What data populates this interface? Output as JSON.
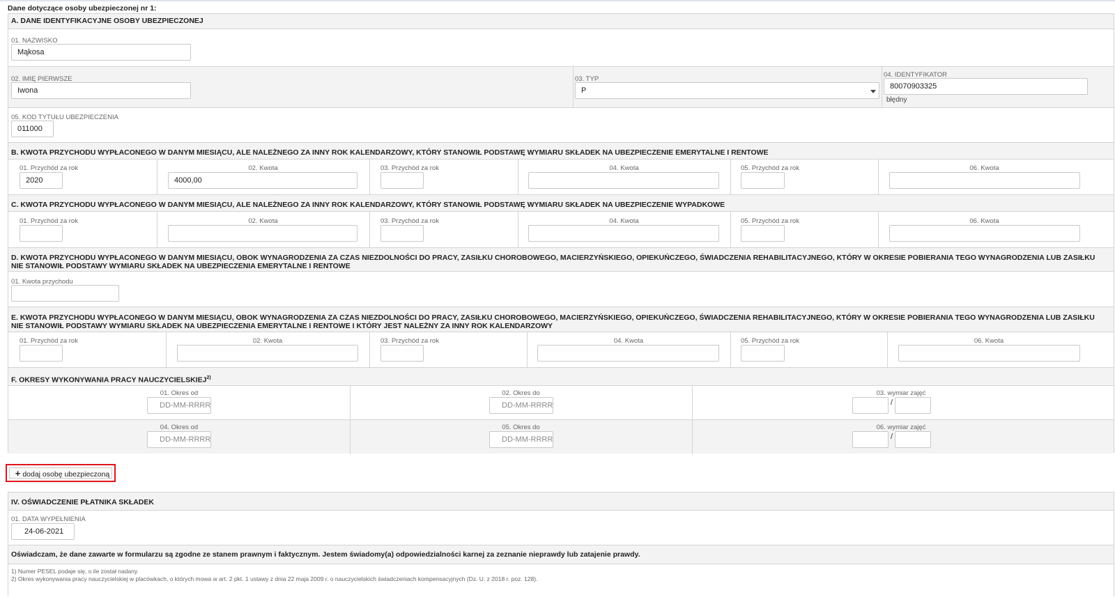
{
  "page_title": "Dane dotyczące osoby ubezpieczonej nr 1:",
  "section_a": {
    "title": "A. DANE IDENTYFIKACYJNE OSOBY UBEZPIECZONEJ",
    "nazwisko_label": "01. NAZWISKO",
    "nazwisko_value": "Mąkosa",
    "imie_label": "02. IMIĘ PIERWSZE",
    "imie_value": "Iwona",
    "typ_label": "03. TYP",
    "typ_value": "P",
    "identyfikator_label": "04. IDENTYFIKATOR",
    "identyfikator_value": "80070903325",
    "identyfikator_error": "błędny",
    "kod_label": "05. KOD TYTUŁU UBEZPIECZENIA",
    "kod_value": "011000"
  },
  "section_b": {
    "title": "B. KWOTA PRZYCHODU WYPŁACONEGO W DANYM MIESIĄCU, ALE NALEŻNEGO ZA INNY ROK KALENDARZOWY, KTÓRY STANOWIŁ PODSTAWĘ WYMIARU SKŁADEK NA UBEZPIECZENIE EMERYTALNE I RENTOWE",
    "labels": [
      "01. Przychód za rok",
      "02. Kwota",
      "03. Przychód za rok",
      "04. Kwota",
      "05. Przychód za rok",
      "06. Kwota"
    ],
    "values": [
      "2020",
      "4000,00",
      "",
      "",
      "",
      ""
    ]
  },
  "section_c": {
    "title": "C. KWOTA PRZYCHODU WYPŁACONEGO W DANYM MIESIĄCU, ALE NALEŻNEGO ZA INNY ROK KALENDARZOWY, KTÓRY STANOWIŁ PODSTAWĘ WYMIARU SKŁADEK NA UBEZPIECZENIE WYPADKOWE",
    "labels": [
      "01. Przychód za rok",
      "02. Kwota",
      "03. Przychód za rok",
      "04. Kwota",
      "05. Przychód za rok",
      "06. Kwota"
    ]
  },
  "section_d": {
    "title_line1": "D. KWOTA PRZYCHODU WYPŁACONEGO W DANYM MIESIĄCU, OBOK WYNAGRODZENIA ZA CZAS NIEZDOLNOŚCI DO PRACY, ZASIŁKU CHOROBOWEGO, MACIERZYŃSKIEGO, OPIEKUŃCZEGO, ŚWIADCZENIA REHABILITACYJNEGO, KTÓRY W OKRESIE POBIERANIA TEGO WYNAGRODZENIA LUB ZASIŁKU",
    "title_line2": "NIE STANOWIŁ PODSTAWY WYMIARU SKŁADEK NA UBEZPIECZENIA EMERYTALNE I RENTOWE",
    "kwota_label": "01. Kwota przychodu"
  },
  "section_e": {
    "title_line1": "E. KWOTA PRZYCHODU WYPŁACONEGO W DANYM MIESIĄCU, OBOK WYNAGRODZENIA ZA CZAS NIEZDOLNOŚCI DO PRACY, ZASIŁKU CHOROBOWEGO, MACIERZYŃSKIEGO, OPIEKUŃCZEGO, ŚWIADCZENIA REHABILITACYJNEGO, KTÓRY W OKRESIE POBIERANIA TEGO WYNAGRODZENIA LUB ZASIŁKU",
    "title_line2": "NIE STANOWIŁ PODSTAWY WYMIARU SKŁADEK NA UBEZPIECZENIA EMERYTALNE I RENTOWE I KTÓRY JEST NALEŻNY ZA INNY ROK KALENDARZOWY",
    "labels": [
      "01. Przychód za rok",
      "02. Kwota",
      "03. Przychód za rok",
      "04. Kwota",
      "05. Przychód za rok",
      "06. Kwota"
    ]
  },
  "section_f": {
    "title": "F. OKRESY WYKONYWANIA PRACY NAUCZYCIELSKIEJ",
    "title_sup": "2)",
    "date_placeholder": "DD-MM-RRRR",
    "row1": {
      "okres_od": "01. Okres od",
      "okres_do": "02. Okres do",
      "wymiar": "03. wymiar zajęć"
    },
    "row2": {
      "okres_od": "04. Okres od",
      "okres_do": "05. Okres do",
      "wymiar": "06. wymiar zajęć"
    },
    "slash": "/"
  },
  "add_button": {
    "icon": "plus-icon",
    "label": "dodaj osobę ubezpieczoną"
  },
  "section_iv": {
    "title": "IV. OŚWIADCZENIE PŁATNIKA SKŁADEK",
    "data_label": "01. DATA WYPEŁNIENIA",
    "data_value": "24-06-2021",
    "statement": "Oświadczam, że dane zawarte w formularzu są zgodne ze stanem prawnym i faktycznym. Jestem świadomy(a) odpowiedzialności karnej za zeznanie nieprawdy lub zatajenie prawdy.",
    "footnote1": "1) Numer PESEL podaje się, o ile został nadany.",
    "footnote2": "2) Okres wykonywania pracy nauczycielskiej w placówkach, o których mowa w art. 2 pkt. 1 ustawy z dnia 22 maja 2009 r. o nauczycielskich świadczeniach kompensacyjnych (Dz. U. z 2018 r. poz. 128)."
  }
}
